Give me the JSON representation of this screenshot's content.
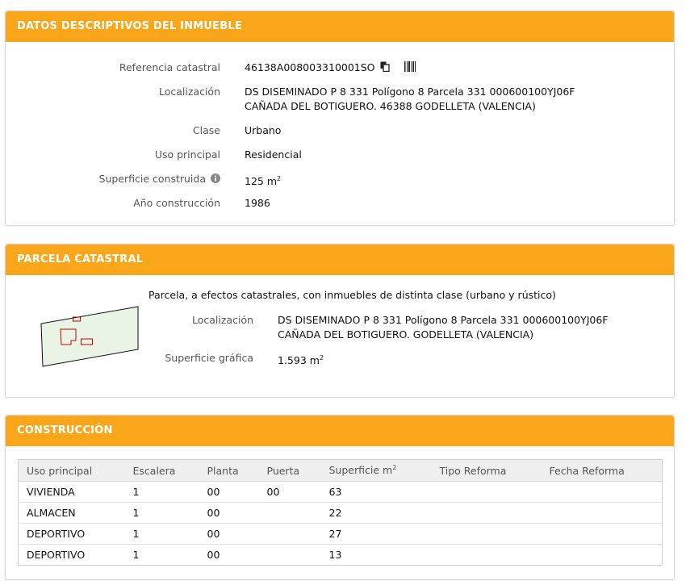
{
  "datos": {
    "title": "DATOS DESCRIPTIVOS DEL INMUEBLE",
    "referencia_label": "Referencia catastral",
    "referencia_value": "46138A008003310001SO",
    "localizacion_label": "Localización",
    "localizacion_line1": "DS DISEMINADO P 8 331 Polígono 8 Parcela 331 000600100YJ06F",
    "localizacion_line2": "CAÑADA DEL BOTIGUERO. 46388 GODELLETA (VALENCIA)",
    "clase_label": "Clase",
    "clase_value": "Urbano",
    "uso_label": "Uso principal",
    "uso_value": "Residencial",
    "superficie_label": "Superficie construida",
    "superficie_value": "125 m",
    "superficie_exp": "2",
    "anio_label": "Año construcción",
    "anio_value": "1986"
  },
  "parcela": {
    "title": "PARCELA CATASTRAL",
    "description": "Parcela, a efectos catastrales, con inmuebles de distinta clase (urbano y rústico)",
    "localizacion_label": "Localización",
    "localizacion_line1": "DS DISEMINADO P 8 331 Polígono 8 Parcela 331 000600100YJ06F",
    "localizacion_line2": "CAÑADA DEL BOTIGUERO. GODELLETA (VALENCIA)",
    "superficie_label": "Superficie gráfica",
    "superficie_value": "1.593 m",
    "superficie_exp": "2"
  },
  "construccion": {
    "title": "CONSTRUCCIÓN",
    "headers": [
      "Uso principal",
      "Escalera",
      "Planta",
      "Puerta",
      "Superficie m",
      "Tipo Reforma",
      "Fecha Reforma"
    ],
    "superficie_exp": "2",
    "rows": [
      [
        "VIVIENDA",
        "1",
        "00",
        "00",
        "63",
        "",
        ""
      ],
      [
        "ALMACEN",
        "1",
        "00",
        "",
        "22",
        "",
        ""
      ],
      [
        "DEPORTIVO",
        "1",
        "00",
        "",
        "27",
        "",
        ""
      ],
      [
        "DEPORTIVO",
        "1",
        "00",
        "",
        "13",
        "",
        ""
      ]
    ]
  },
  "colors": {
    "accent": "#faa61a",
    "parcel_fill": "#e9f4e4",
    "building_outline": "#cc0000"
  },
  "icons": [
    "copy-icon",
    "barcode-icon",
    "info-icon"
  ]
}
